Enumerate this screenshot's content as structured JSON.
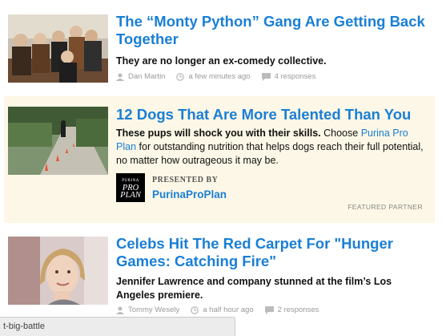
{
  "articles": [
    {
      "title": "The “Monty Python” Gang Are Getting Back Together",
      "dek": "They are no longer an ex-comedy collective.",
      "author": "Dan Martin",
      "time": "a few minutes ago",
      "responses": "4 responses",
      "image": "group-photo"
    },
    {
      "title": "12 Dogs That Are More Talented Than You",
      "dek_bold": "These pups will shock you with their skills.",
      "dek_pre": "Choose",
      "dek_link": "Purina Pro Plan",
      "dek_post": "for outstanding nutrition that helps dogs reach their full potential, no matter how outrageous it may be.",
      "presented_label": "PRESENTED BY",
      "sponsor_name": "PurinaProPlan",
      "logo_line1": "PURINA",
      "logo_line2": "PRO",
      "logo_line3": "PLAN",
      "featured_label": "FEATURED PARTNER",
      "image": "dog-agility-photo"
    },
    {
      "title": "Celebs Hit The Red Carpet For \"Hunger Games: Catching Fire\"",
      "dek": "Jennifer Lawrence and company stunned at the film’s Los Angeles premiere.",
      "author": "Tommy Wesely",
      "time": "a half hour ago",
      "responses": "2 responses",
      "image": "portrait-photo"
    }
  ],
  "status_bar": "t-big-battle",
  "colors": {
    "link": "#1a7fd6",
    "sponsored_bg": "#fcf7e6",
    "meta": "#9a9a9a"
  }
}
